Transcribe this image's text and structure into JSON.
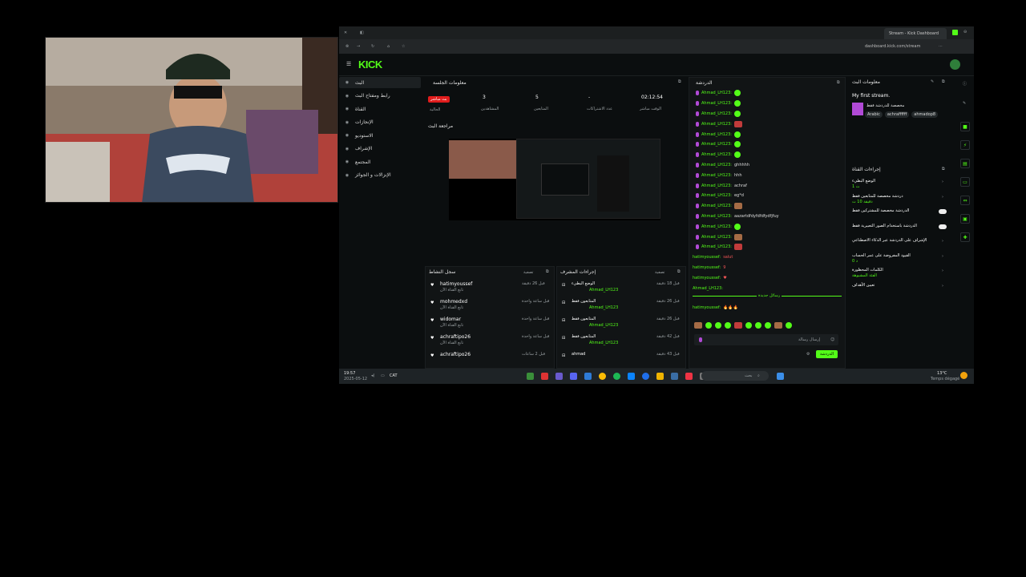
{
  "browser": {
    "tab_title": "Stream - Kick Dashboard",
    "url": "dashboard.kick.com/stream"
  },
  "brand": {
    "logo": "KICK",
    "accent": "#53fc18"
  },
  "sidebar": {
    "items": [
      {
        "label": "البث",
        "icon": "broadcast-icon"
      },
      {
        "label": "رابط ومفتاح البث",
        "icon": "key-icon"
      },
      {
        "label": "القناة",
        "icon": "channel-icon"
      },
      {
        "label": "الإنجازات",
        "icon": "trophy-icon"
      },
      {
        "label": "الاستوديو",
        "icon": "studio-icon"
      },
      {
        "label": "الإشراف",
        "icon": "shield-icon"
      },
      {
        "label": "المجتمع",
        "icon": "community-icon"
      },
      {
        "label": "الإنزالات و الجوائز",
        "icon": "gift-icon"
      }
    ]
  },
  "session": {
    "title": "معلومات الجلسة",
    "live_badge": "بث مباشر",
    "live_sub": "الحالية",
    "stats": [
      {
        "value": "3",
        "label": "المشاهدين"
      },
      {
        "value": "5",
        "label": "المتابعين"
      },
      {
        "value": "-",
        "label": "عدد الاشتراكات"
      },
      {
        "value": "02:12:54",
        "label": "الوقت مباشر"
      }
    ]
  },
  "preview": {
    "title": "مراجعة البث"
  },
  "activity": {
    "title": "سجل النشاط",
    "filter": "تصفية",
    "items": [
      {
        "name": "hatimyoussef",
        "sub": "تابع القناة الآن",
        "time": "قبل 26 دقيقة"
      },
      {
        "name": "mohmedxd",
        "sub": "تابع القناة الآن",
        "time": "قبل ساعة واحدة"
      },
      {
        "name": "widomar",
        "sub": "تابع القناة الآن",
        "time": "قبل ساعة واحدة"
      },
      {
        "name": "achraftipo26",
        "sub": "تابع القناة الآن",
        "time": "قبل ساعة واحدة"
      },
      {
        "name": "achraftipo26",
        "sub": "",
        "time": "قبل 2 ساعات"
      }
    ]
  },
  "modlog": {
    "title": "إجراءات المشرف",
    "filter": "تصفية",
    "items": [
      {
        "title": "الوضع البطيء",
        "by": "Ahmad_LH123",
        "time": "قبل 18 دقيقة"
      },
      {
        "title": "المتابعون فقط",
        "by": "Ahmad_LH123",
        "time": "قبل 26 دقيقة"
      },
      {
        "title": "المتابعون فقط",
        "by": "Ahmad_LH123",
        "time": "قبل 26 دقيقة"
      },
      {
        "title": "المتابعون فقط",
        "by": "Ahmad_LH123",
        "time": "قبل 42 دقيقة"
      },
      {
        "title": "ahmad",
        "by": "",
        "time": "قبل 43 دقيقة"
      }
    ]
  },
  "chat": {
    "title": "الدردشة",
    "lines": [
      {
        "user": "Ahmad_LH123:",
        "text": "",
        "emote": "g"
      },
      {
        "user": "Ahmad_LH123:",
        "text": "",
        "emote": "g"
      },
      {
        "user": "Ahmad_LH123:",
        "text": "",
        "emote": "g"
      },
      {
        "user": "Ahmad_LH123:",
        "text": "",
        "emote": "r"
      },
      {
        "user": "Ahmad_LH123:",
        "text": "",
        "emote": "g"
      },
      {
        "user": "Ahmad_LH123:",
        "text": "",
        "emote": "g"
      },
      {
        "user": "Ahmad_LH123:",
        "text": "",
        "emote": "g"
      },
      {
        "user": "Ahmad_LH123:",
        "text": "ghhhhh",
        "emote": ""
      },
      {
        "user": "Ahmad_LH123:",
        "text": "hhh",
        "emote": ""
      },
      {
        "user": "Ahmad_LH123:",
        "text": "achraf",
        "emote": ""
      },
      {
        "user": "Ahmad_LH123:",
        "text": "eg*d",
        "emote": ""
      },
      {
        "user": "Ahmad_LH123:",
        "text": "",
        "emote": "p"
      },
      {
        "user": "Ahmad_LH123:",
        "text": "aazartdfdyfdfdfydfjfuy",
        "emote": ""
      },
      {
        "user": "Ahmad_LH123:",
        "text": "",
        "emote": "g"
      },
      {
        "user": "Ahmad_LH123:",
        "text": "",
        "emote": "p"
      },
      {
        "user": "Ahmad_LH123:",
        "text": "",
        "emote": "r"
      }
    ],
    "lines2": [
      {
        "user": "hatimyoussef:",
        "text": "salut"
      },
      {
        "user": "hatimyoussef:",
        "text": "9"
      },
      {
        "user": "hatimyoussef:",
        "text": "♥"
      },
      {
        "user": "Ahmad_LH123:",
        "text": ""
      }
    ],
    "new_messages": "رسائل جديدة",
    "last_line": {
      "user": "hatimyoussef:",
      "text": "🔥🔥🔥"
    },
    "input_placeholder": "إرسال رسالة",
    "send": "الدردشة"
  },
  "stream_info": {
    "title": "معلومات البث",
    "stream_title": "My first stream.",
    "category": "مخصصة للدردشة فقط",
    "tags": [
      "Arabic",
      "achraffffff",
      "ahmadop8"
    ]
  },
  "quick_actions": {
    "title": "إجراءات القناة",
    "items": [
      {
        "label": "الوضع البطيء",
        "sub": "1 ث"
      },
      {
        "label": "دردشة مخصصة للمتابعين فقط",
        "sub": "دقيقة 10 ث"
      },
      {
        "label": "الدردشة مخصصة للمشتركين فقط",
        "sub": ""
      },
      {
        "label": "الدردشة باستخدام الصور التعبيرية فقط",
        "sub": ""
      },
      {
        "label": "الإشراف على الدردشة عبر الذكاء الاصطناعي",
        "sub": ""
      },
      {
        "label": "القيود المفروضة على عمر الحساب",
        "sub": "0 د"
      },
      {
        "label": "الكلمات المحظورة",
        "sub": "الفئة المشبوهة"
      },
      {
        "label": "تعيين الأهداف",
        "sub": ""
      }
    ]
  },
  "taskbar": {
    "time": "19:57",
    "date": "2025-05-12",
    "lang": "CAT",
    "search": "بحث",
    "weather": "13°C",
    "weather_sub": "Temps dégagé"
  }
}
